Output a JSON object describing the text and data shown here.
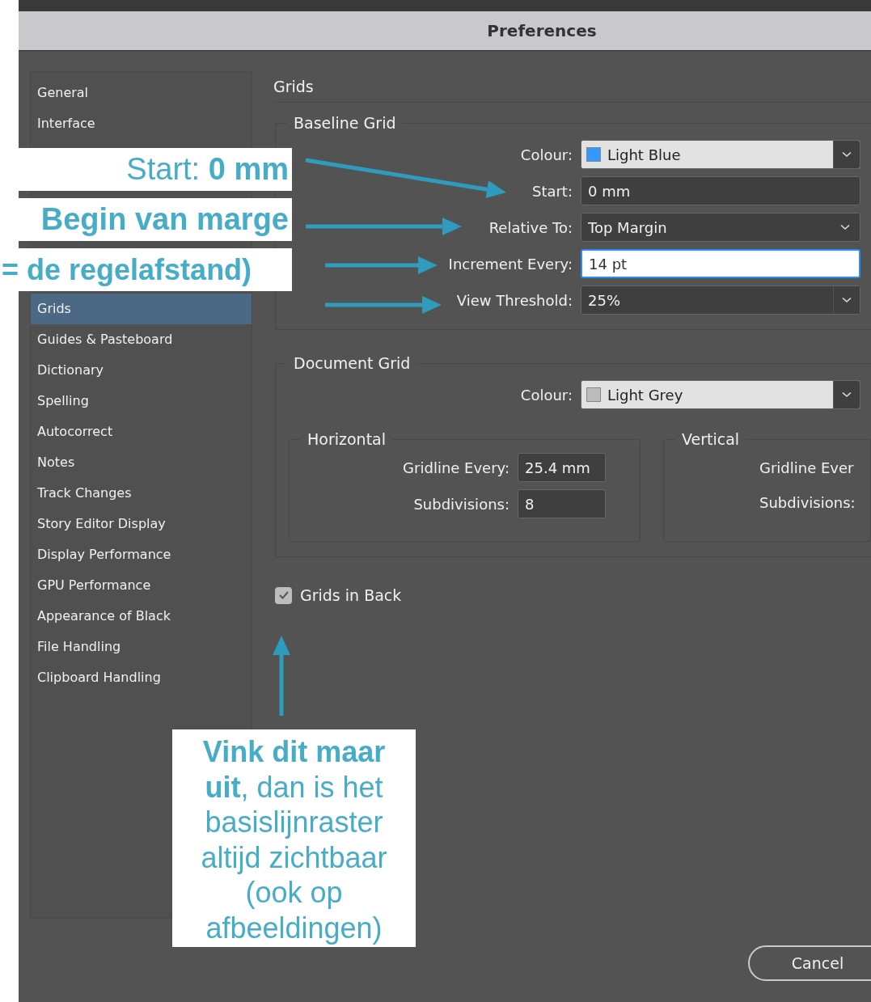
{
  "window": {
    "title": "Preferences"
  },
  "sidebar": {
    "items_top": [
      {
        "label": "General",
        "selected": false
      },
      {
        "label": "Interface",
        "selected": false
      }
    ],
    "items": [
      {
        "label": "Grids",
        "selected": true
      },
      {
        "label": "Guides & Pasteboard",
        "selected": false
      },
      {
        "label": "Dictionary",
        "selected": false
      },
      {
        "label": "Spelling",
        "selected": false
      },
      {
        "label": "Autocorrect",
        "selected": false
      },
      {
        "label": "Notes",
        "selected": false
      },
      {
        "label": "Track Changes",
        "selected": false
      },
      {
        "label": "Story Editor Display",
        "selected": false
      },
      {
        "label": "Display Performance",
        "selected": false
      },
      {
        "label": "GPU Performance",
        "selected": false
      },
      {
        "label": "Appearance of Black",
        "selected": false
      },
      {
        "label": "File Handling",
        "selected": false
      },
      {
        "label": "Clipboard Handling",
        "selected": false
      }
    ]
  },
  "panel": {
    "title": "Grids",
    "baseline_grid": {
      "title": "Baseline Grid",
      "rows": [
        {
          "kind": "colour",
          "label": "Colour:",
          "value": "Light Blue",
          "color": "#3399ff"
        },
        {
          "kind": "text",
          "label": "Start:",
          "value": "0 mm",
          "focused": false
        },
        {
          "kind": "select",
          "label": "Relative To:",
          "value": "Top Margin"
        },
        {
          "kind": "text",
          "label": "Increment Every:",
          "value": "14 pt",
          "focused": true
        },
        {
          "kind": "combo",
          "label": "View Threshold:",
          "value": "25%"
        }
      ]
    },
    "document_grid": {
      "title": "Document Grid",
      "colour": {
        "label": "Colour:",
        "value": "Light Grey",
        "color": "#bcbcbc"
      },
      "horizontal": {
        "title": "Horizontal",
        "rows": [
          {
            "label": "Gridline Every:",
            "value": "25.4 mm"
          },
          {
            "label": "Subdivisions:",
            "value": "8"
          }
        ]
      },
      "vertical": {
        "title": "Vertical",
        "rows": [
          {
            "label": "Gridline Ever"
          },
          {
            "label": "Subdivisions:"
          }
        ]
      }
    },
    "grids_in_back": {
      "label": "Grids in Back",
      "checked": true
    }
  },
  "buttons": [
    "Cancel"
  ],
  "annotations": [
    {
      "text": "Start: **0 mm**"
    },
    {
      "text": "Begin van marge"
    },
    {
      "text": "= de regelafstand)"
    }
  ],
  "note": {
    "text": "**Vink dit maar uit**, dan is het basislijnraster altijd zichtbaar (ook op afbeeldingen)"
  }
}
